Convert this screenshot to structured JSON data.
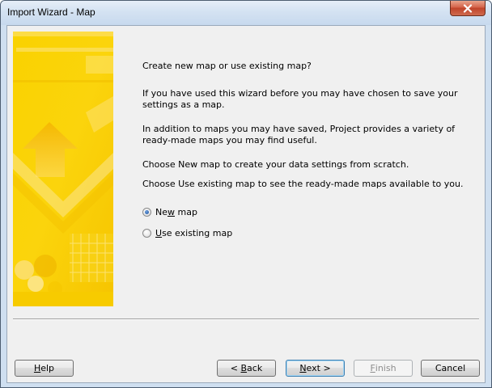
{
  "window": {
    "title": "Import Wizard - Map"
  },
  "content": {
    "heading": "Create new map or use existing map?",
    "para1": "If you have used this wizard before you may have chosen to save your settings as a map.",
    "para2": "In addition to maps you may have saved, Project provides a variety of ready-made maps you may find useful.",
    "para3": "Choose New map to create your data settings from scratch.",
    "para4": "Choose Use existing map to see the ready-made maps available to you."
  },
  "options": {
    "new_map": {
      "prefix": "Ne",
      "accel": "w",
      "suffix": " map",
      "selected": true
    },
    "use_existing": {
      "prefix": "",
      "accel": "U",
      "suffix": "se existing map",
      "selected": false
    }
  },
  "buttons": {
    "help": {
      "prefix": "",
      "accel": "H",
      "suffix": "elp"
    },
    "back": {
      "prefix": "< ",
      "accel": "B",
      "suffix": "ack"
    },
    "next": {
      "prefix": "",
      "accel": "N",
      "suffix": "ext >"
    },
    "finish": {
      "prefix": "",
      "accel": "F",
      "suffix": "inish",
      "enabled": false
    },
    "cancel": {
      "label": "Cancel"
    }
  },
  "colors": {
    "accent_yellow": "#f7c600",
    "title_bar": "#d4e2f2",
    "close_button": "#c7432a"
  }
}
